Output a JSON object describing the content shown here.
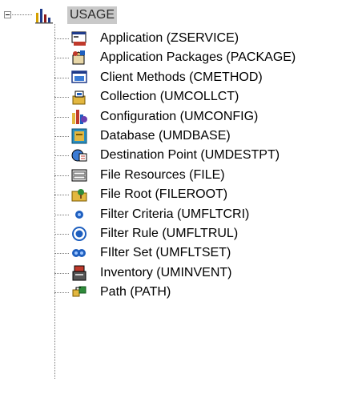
{
  "root": {
    "label": "USAGE",
    "expanded": true,
    "icon": "bar-chart-icon"
  },
  "items": [
    {
      "label": "Application (ZSERVICE)",
      "icon": "application-icon"
    },
    {
      "label": "Application Packages (PACKAGE)",
      "icon": "package-icon"
    },
    {
      "label": "Client Methods (CMETHOD)",
      "icon": "client-methods-icon"
    },
    {
      "label": "Collection (UMCOLLCT)",
      "icon": "collection-icon"
    },
    {
      "label": "Configuration (UMCONFIG)",
      "icon": "configuration-icon"
    },
    {
      "label": "Database (UMDBASE)",
      "icon": "database-icon"
    },
    {
      "label": "Destination Point (UMDESTPT)",
      "icon": "destination-point-icon"
    },
    {
      "label": "File Resources (FILE)",
      "icon": "file-resources-icon"
    },
    {
      "label": "File Root (FILEROOT)",
      "icon": "file-root-icon"
    },
    {
      "label": "Filter Criteria (UMFLTCRI)",
      "icon": "filter-criteria-icon"
    },
    {
      "label": "Filter Rule (UMFLTRUL)",
      "icon": "filter-rule-icon"
    },
    {
      "label": "FIlter Set (UMFLTSET)",
      "icon": "filter-set-icon"
    },
    {
      "label": "Inventory (UMINVENT)",
      "icon": "inventory-icon"
    },
    {
      "label": "Path (PATH)",
      "icon": "path-icon"
    }
  ]
}
